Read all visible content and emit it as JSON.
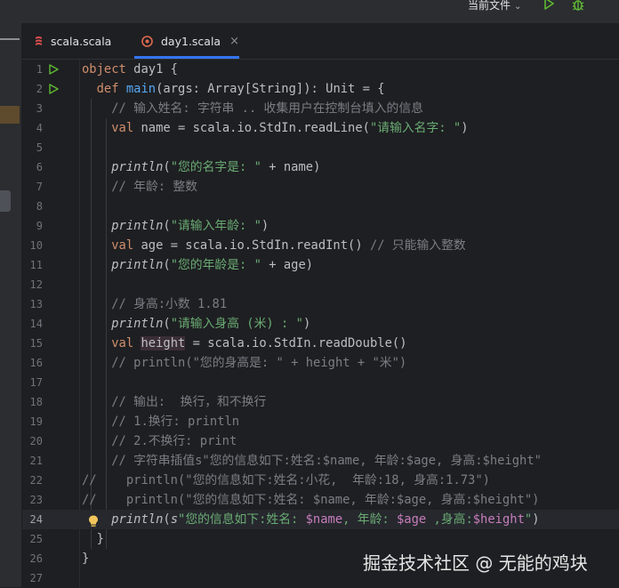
{
  "toolbar": {
    "run_config_label": "当前文件",
    "colors": {
      "run": "#5fb832",
      "debug": "#5fb832"
    }
  },
  "tabs": [
    {
      "label": "scala.scala",
      "active": false,
      "icon": "scala-file-icon"
    },
    {
      "label": "day1.scala",
      "active": true,
      "icon": "scala-file-icon",
      "close": "×"
    }
  ],
  "editor": {
    "lines": [
      {
        "n": "1",
        "text": "object day1 {"
      },
      {
        "n": "2",
        "text": "  def main(args: Array[String]): Unit = {"
      },
      {
        "n": "3",
        "text": "    // 输入姓名: 字符串 .. 收集用户在控制台填入的信息"
      },
      {
        "n": "4",
        "text": "    val name = scala.io.StdIn.readLine(\"请输入名字: \")"
      },
      {
        "n": "5",
        "text": ""
      },
      {
        "n": "6",
        "text": "    println(\"您的名字是: \" + name)"
      },
      {
        "n": "7",
        "text": "    // 年龄: 整数"
      },
      {
        "n": "8",
        "text": ""
      },
      {
        "n": "9",
        "text": "    println(\"请输入年龄: \")"
      },
      {
        "n": "10",
        "text": "    val age = scala.io.StdIn.readInt() // 只能输入整数"
      },
      {
        "n": "11",
        "text": "    println(\"您的年龄是: \" + age)"
      },
      {
        "n": "12",
        "text": ""
      },
      {
        "n": "13",
        "text": "    // 身高:小数 1.81"
      },
      {
        "n": "14",
        "text": "    println(\"请输入身高 (米) : \")"
      },
      {
        "n": "15",
        "text": "    val height = scala.io.StdIn.readDouble()"
      },
      {
        "n": "16",
        "text": "    // println(\"您的身高是: \" + height + \"米\")"
      },
      {
        "n": "17",
        "text": ""
      },
      {
        "n": "18",
        "text": "    // 输出:  换行，和不换行"
      },
      {
        "n": "19",
        "text": "    // 1.换行: println"
      },
      {
        "n": "20",
        "text": "    // 2.不换行: print"
      },
      {
        "n": "21",
        "text": "    // 字符串插值s\"您的信息如下:姓名:$name, 年龄:$age, 身高:$height\""
      },
      {
        "n": "22",
        "text": "//    println(\"您的信息如下:姓名:小花,  年龄:18, 身高:1.73\")"
      },
      {
        "n": "23",
        "text": "//    println(\"您的信息如下:姓名: $name, 年龄:$age, 身高:$height\")"
      },
      {
        "n": "24",
        "text": "    println(s\"您的信息如下:姓名: $name, 年龄: $age ,身高:$height\")"
      },
      {
        "n": "25",
        "text": "  }"
      },
      {
        "n": "26",
        "text": "}"
      },
      {
        "n": "27",
        "text": ""
      }
    ],
    "current_line": "24"
  },
  "watermark": "掘金技术社区 @ 无能的鸡块"
}
